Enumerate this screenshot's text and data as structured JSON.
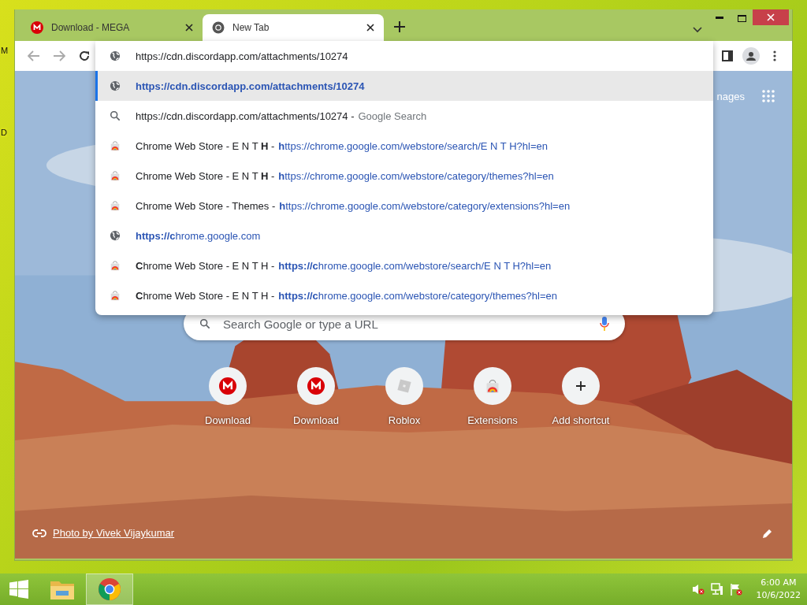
{
  "desktop": {
    "edge_labels": [
      "M",
      "D"
    ]
  },
  "browser": {
    "tabs": [
      {
        "title": "Download - MEGA",
        "kind": "mega",
        "selected": false
      },
      {
        "title": "New Tab",
        "kind": "chrome",
        "selected": true
      }
    ],
    "omnibox": {
      "value": "https://cdn.discordapp.com/attachments/10274"
    },
    "suggestions": [
      {
        "kind": "globe",
        "selected": true,
        "detail": "**https://cdn.discordapp.com/attachments/10274**"
      },
      {
        "kind": "search",
        "selected": false,
        "main": "https://cdn.discordapp.com/attachments/10274 -",
        "detail": "Google Search"
      },
      {
        "kind": "store",
        "selected": false,
        "main": "Chrome Web Store - E N T **H** -",
        "detail": "**h**ttps://chrome.google.com/webstore/search/E N T H?hl=en"
      },
      {
        "kind": "store",
        "selected": false,
        "main": "Chrome Web Store - E N T **H** -",
        "detail": "**h**ttps://chrome.google.com/webstore/category/themes?hl=en"
      },
      {
        "kind": "store",
        "selected": false,
        "main": "Chrome Web Store - Themes -",
        "detail": "**h**ttps://chrome.google.com/webstore/category/extensions?hl=en"
      },
      {
        "kind": "globe",
        "selected": false,
        "detail": "**https://c**hrome.google.com"
      },
      {
        "kind": "store",
        "selected": false,
        "main": "**C**hrome Web Store - E N T H -",
        "detail": "**https://c**hrome.google.com/webstore/search/E N T H?hl=en"
      },
      {
        "kind": "store",
        "selected": false,
        "main": "**C**hrome Web Store - E N T H -",
        "detail": "**https://c**hrome.google.com/webstore/category/themes?hl=en"
      }
    ],
    "new_tab": {
      "header_link": "nages",
      "search": {
        "placeholder": "Search Google or type a URL"
      },
      "shortcuts": [
        {
          "label": "Download",
          "kind": "mega"
        },
        {
          "label": "Download",
          "kind": "mega"
        },
        {
          "label": "Roblox",
          "kind": "roblox"
        },
        {
          "label": "Extensions",
          "kind": "store"
        },
        {
          "label": "Add shortcut",
          "kind": "add"
        }
      ],
      "photo_credit": "Photo by Vivek Vijaykumar"
    }
  },
  "taskbar": {
    "apps": [
      {
        "kind": "explorer",
        "selected": false
      },
      {
        "kind": "chrome",
        "selected": true
      }
    ],
    "time": "6:00 AM",
    "date": "10/6/2022"
  }
}
